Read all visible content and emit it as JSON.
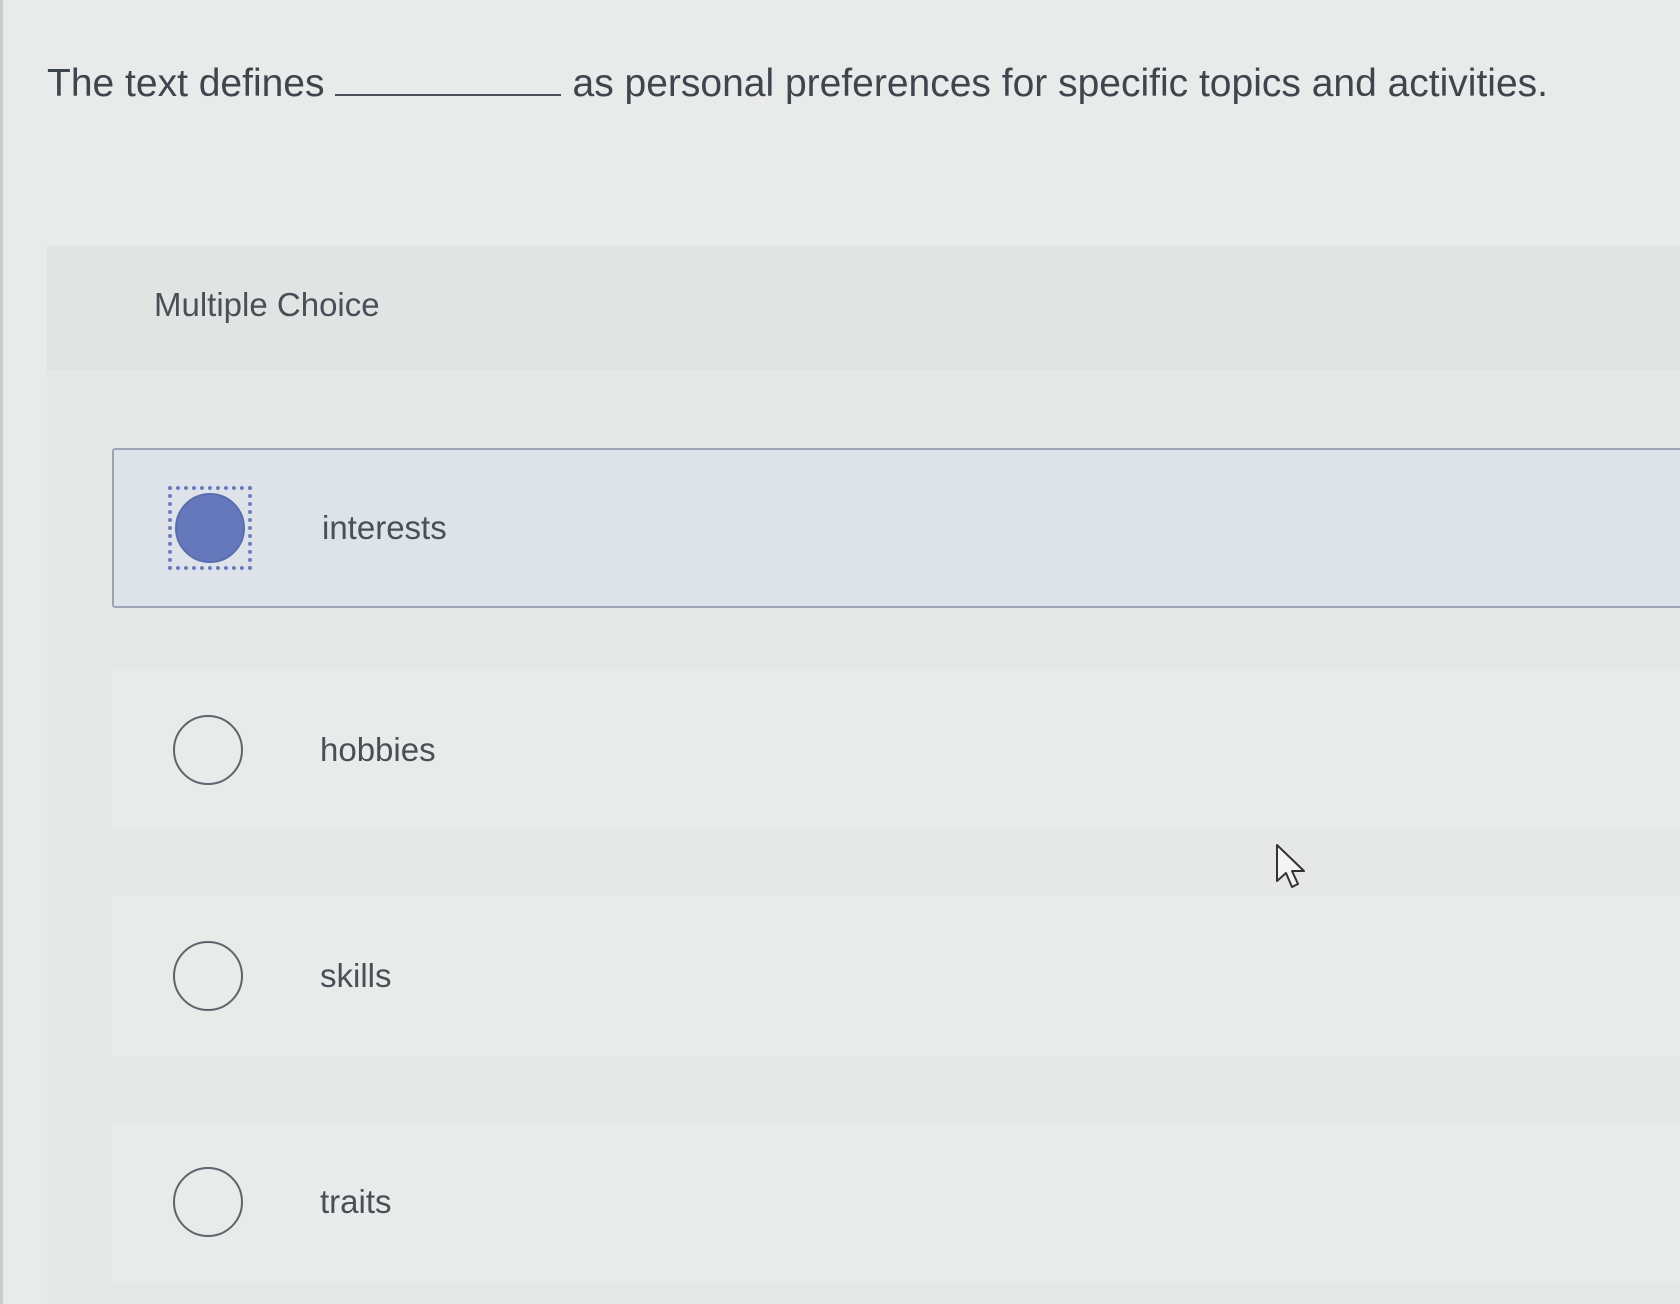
{
  "question": {
    "before_blank": "The text defines",
    "after_blank": "as personal preferences for specific topics and activities."
  },
  "section": {
    "label": "Multiple Choice"
  },
  "options": [
    {
      "label": "interests",
      "selected": true
    },
    {
      "label": "hobbies",
      "selected": false
    },
    {
      "label": "skills",
      "selected": false
    },
    {
      "label": "traits",
      "selected": false
    }
  ],
  "colors": {
    "accent": "#6578bb",
    "selected_bg": "#dde3e8",
    "page_bg": "#e9eaea"
  },
  "icons": {
    "cursor": "arrow-cursor-icon"
  }
}
